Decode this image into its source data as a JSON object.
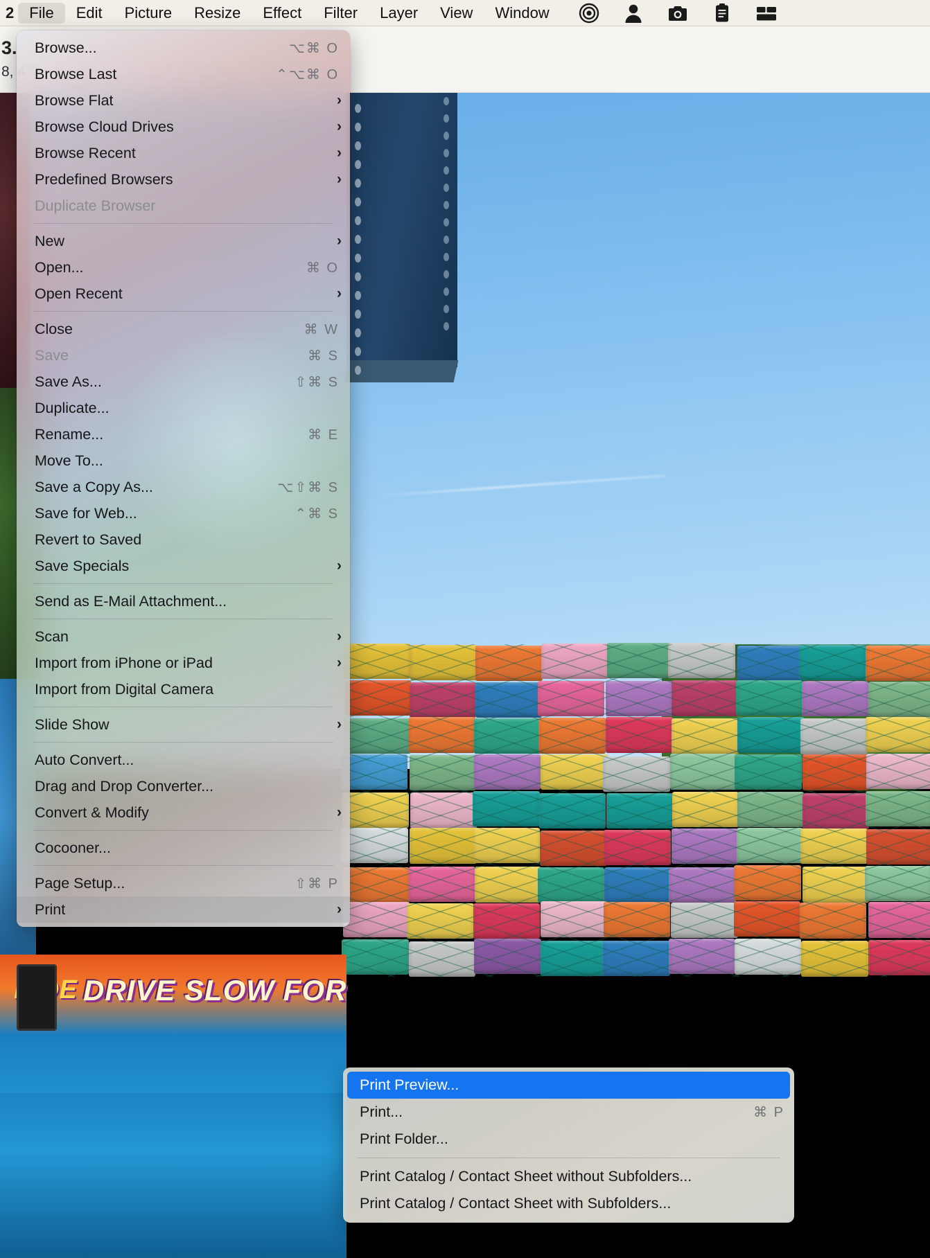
{
  "menubar": {
    "leading_label": "2",
    "items": [
      {
        "label": "File",
        "active": true
      },
      {
        "label": "Edit",
        "active": false
      },
      {
        "label": "Picture",
        "active": false
      },
      {
        "label": "Resize",
        "active": false
      },
      {
        "label": "Effect",
        "active": false
      },
      {
        "label": "Filter",
        "active": false
      },
      {
        "label": "Layer",
        "active": false
      },
      {
        "label": "View",
        "active": false
      },
      {
        "label": "Window",
        "active": false
      }
    ],
    "icons": [
      "target-icon",
      "person-icon",
      "camera-icon",
      "clipboard-icon",
      "window-tile-icon"
    ]
  },
  "document_info": {
    "line1": "3.",
    "line2": "8, 4"
  },
  "file_menu": {
    "name": "File",
    "groups": [
      [
        {
          "label": "Browse...",
          "shortcut": "⌥⌘ O",
          "arrow": false,
          "disabled": false
        },
        {
          "label": "Browse Last",
          "shortcut": "⌃⌥⌘ O",
          "arrow": false,
          "disabled": false
        },
        {
          "label": "Browse Flat",
          "shortcut": "",
          "arrow": true,
          "disabled": false
        },
        {
          "label": "Browse Cloud Drives",
          "shortcut": "",
          "arrow": true,
          "disabled": false
        },
        {
          "label": "Browse Recent",
          "shortcut": "",
          "arrow": true,
          "disabled": false
        },
        {
          "label": "Predefined Browsers",
          "shortcut": "",
          "arrow": true,
          "disabled": false
        },
        {
          "label": "Duplicate Browser",
          "shortcut": "",
          "arrow": false,
          "disabled": true
        }
      ],
      [
        {
          "label": "New",
          "shortcut": "",
          "arrow": true,
          "disabled": false
        },
        {
          "label": "Open...",
          "shortcut": "⌘ O",
          "arrow": false,
          "disabled": false
        },
        {
          "label": "Open Recent",
          "shortcut": "",
          "arrow": true,
          "disabled": false
        }
      ],
      [
        {
          "label": "Close",
          "shortcut": "⌘ W",
          "arrow": false,
          "disabled": false
        },
        {
          "label": "Save",
          "shortcut": "⌘ S",
          "arrow": false,
          "disabled": true
        },
        {
          "label": "Save As...",
          "shortcut": "⇧⌘ S",
          "arrow": false,
          "disabled": false
        },
        {
          "label": "Duplicate...",
          "shortcut": "",
          "arrow": false,
          "disabled": false
        },
        {
          "label": "Rename...",
          "shortcut": "⌘ E",
          "arrow": false,
          "disabled": false
        },
        {
          "label": "Move To...",
          "shortcut": "",
          "arrow": false,
          "disabled": false
        },
        {
          "label": "Save a Copy As...",
          "shortcut": "⌥⇧⌘ S",
          "arrow": false,
          "disabled": false
        },
        {
          "label": "Save for Web...",
          "shortcut": "⌃⌘ S",
          "arrow": false,
          "disabled": false
        },
        {
          "label": "Revert to Saved",
          "shortcut": "",
          "arrow": false,
          "disabled": false
        },
        {
          "label": "Save Specials",
          "shortcut": "",
          "arrow": true,
          "disabled": false
        }
      ],
      [
        {
          "label": "Send as E-Mail Attachment...",
          "shortcut": "",
          "arrow": false,
          "disabled": false
        }
      ],
      [
        {
          "label": "Scan",
          "shortcut": "",
          "arrow": true,
          "disabled": false
        },
        {
          "label": "Import from iPhone or iPad",
          "shortcut": "",
          "arrow": true,
          "disabled": false
        },
        {
          "label": "Import from Digital Camera",
          "shortcut": "",
          "arrow": false,
          "disabled": false
        }
      ],
      [
        {
          "label": "Slide Show",
          "shortcut": "",
          "arrow": true,
          "disabled": false
        }
      ],
      [
        {
          "label": "Auto Convert...",
          "shortcut": "",
          "arrow": false,
          "disabled": false
        },
        {
          "label": "Drag and Drop Converter...",
          "shortcut": "",
          "arrow": false,
          "disabled": false
        },
        {
          "label": "Convert & Modify",
          "shortcut": "",
          "arrow": true,
          "disabled": false
        }
      ],
      [
        {
          "label": "Cocooner...",
          "shortcut": "",
          "arrow": false,
          "disabled": false
        }
      ],
      [
        {
          "label": "Page Setup...",
          "shortcut": "⇧⌘ P",
          "arrow": false,
          "disabled": false
        },
        {
          "label": "Print",
          "shortcut": "",
          "arrow": true,
          "disabled": false,
          "highlighted": true
        }
      ]
    ]
  },
  "print_submenu": {
    "name": "Print",
    "groups": [
      [
        {
          "label": "Print Preview...",
          "shortcut": "",
          "selected": true
        },
        {
          "label": "Print...",
          "shortcut": "⌘ P",
          "selected": false
        },
        {
          "label": "Print Folder...",
          "shortcut": "",
          "selected": false
        }
      ],
      [
        {
          "label": "Print Catalog / Contact Sheet without Subfolders...",
          "shortcut": "",
          "selected": false
        },
        {
          "label": "Print Catalog / Contact Sheet with Subfolders...",
          "shortcut": "",
          "selected": false
        }
      ]
    ]
  },
  "photo": {
    "description": "stacked-colorful-plastic-crates-under-blue-sky",
    "banner_text_1": "DRIVE SLOW FOR",
    "banner_text_2": "RIDE"
  },
  "colors": {
    "selection_blue": "#1575f0",
    "menubar_bg": "#f2efe9",
    "menu_text": "#16161a",
    "disabled_text": "#8b8b90",
    "shortcut_text": "#6f7278"
  }
}
